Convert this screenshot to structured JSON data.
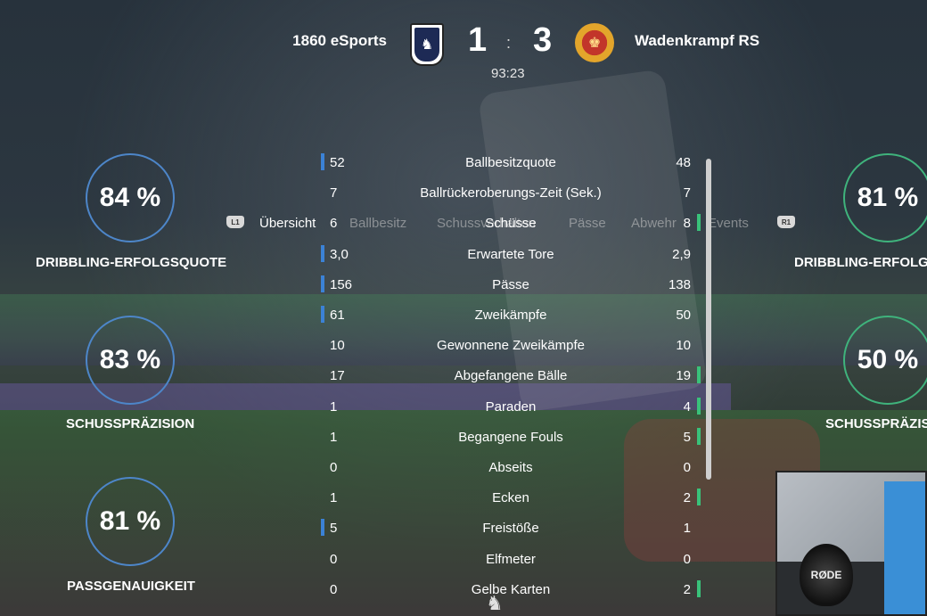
{
  "header": {
    "home_team": "1860 eSports",
    "away_team": "Wadenkrampf RS",
    "home_score": "1",
    "separator": ":",
    "away_score": "3",
    "clock": "93:23",
    "home_crest_icon": "tsv-1860-lion-crest-icon",
    "away_crest_icon": "wadenkrampf-crest-icon"
  },
  "tabs": {
    "left_bumper": "L1",
    "right_bumper": "R1",
    "items": [
      "Übersicht",
      "Ballbesitz",
      "Schussverhalten",
      "Pässe",
      "Abwehr",
      "Events"
    ],
    "active_index": 0
  },
  "home_rings": [
    {
      "value": "84 %",
      "label": "DRIBBLING-ERFOLGSQUOTE"
    },
    {
      "value": "83 %",
      "label": "SCHUSSPRÄZISION"
    },
    {
      "value": "81 %",
      "label": "PASSGENAUIGKEIT"
    }
  ],
  "away_rings": [
    {
      "value": "81 %",
      "label": "DRIBBLING-ERFOLG"
    },
    {
      "value": "50 %",
      "label": "SCHUSSPRÄZIS"
    }
  ],
  "stats": [
    {
      "name": "Ballbesitzquote",
      "home": "52",
      "away": "48",
      "leader": "home"
    },
    {
      "name": "Ballrückeroberungs-Zeit (Sek.)",
      "home": "7",
      "away": "7",
      "leader": "none"
    },
    {
      "name": "Schüsse",
      "home": "6",
      "away": "8",
      "leader": "away"
    },
    {
      "name": "Erwartete Tore",
      "home": "3,0",
      "away": "2,9",
      "leader": "home"
    },
    {
      "name": "Pässe",
      "home": "156",
      "away": "138",
      "leader": "home"
    },
    {
      "name": "Zweikämpfe",
      "home": "61",
      "away": "50",
      "leader": "home"
    },
    {
      "name": "Gewonnene Zweikämpfe",
      "home": "10",
      "away": "10",
      "leader": "none"
    },
    {
      "name": "Abgefangene Bälle",
      "home": "17",
      "away": "19",
      "leader": "away"
    },
    {
      "name": "Paraden",
      "home": "1",
      "away": "4",
      "leader": "away"
    },
    {
      "name": "Begangene Fouls",
      "home": "1",
      "away": "5",
      "leader": "away"
    },
    {
      "name": "Abseits",
      "home": "0",
      "away": "0",
      "leader": "none"
    },
    {
      "name": "Ecken",
      "home": "1",
      "away": "2",
      "leader": "away"
    },
    {
      "name": "Freistöße",
      "home": "5",
      "away": "1",
      "leader": "home"
    },
    {
      "name": "Elfmeter",
      "home": "0",
      "away": "0",
      "leader": "none"
    },
    {
      "name": "Gelbe Karten",
      "home": "0",
      "away": "2",
      "leader": "away"
    }
  ],
  "webcam": {
    "mic_brand": "RØDE"
  },
  "colors": {
    "home_accent": "#3b82d6",
    "away_accent": "#39c27a"
  }
}
